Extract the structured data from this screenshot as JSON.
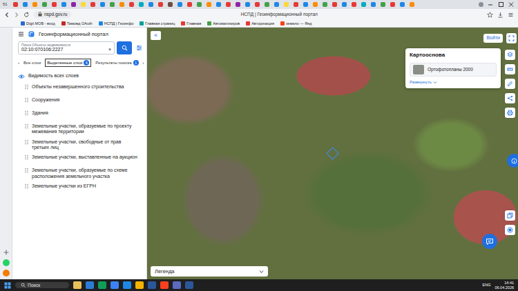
{
  "browser": {
    "tab_count": "51",
    "tabs": [
      {
        "color": "#e53935"
      },
      {
        "color": "#1e88e5"
      },
      {
        "color": "#fb8c00"
      },
      {
        "color": "#43a047"
      },
      {
        "color": "#e53935"
      },
      {
        "color": "#1e88e5"
      },
      {
        "color": "#8e24aa"
      },
      {
        "color": "#fdd835"
      },
      {
        "color": "#e53935"
      },
      {
        "color": "#1e88e5"
      },
      {
        "color": "#43a047"
      },
      {
        "color": "#fb8c00"
      },
      {
        "color": "#e53935"
      },
      {
        "color": "#00acc1"
      },
      {
        "color": "#1e88e5"
      },
      {
        "color": "#e53935"
      },
      {
        "color": "#6d4c41"
      },
      {
        "color": "#1e88e5"
      },
      {
        "color": "#e53935"
      },
      {
        "color": "#43a047"
      },
      {
        "color": "#fb8c00"
      },
      {
        "color": "#1e88e5"
      },
      {
        "color": "#e53935"
      },
      {
        "color": "#8e24aa"
      },
      {
        "color": "#1e88e5"
      },
      {
        "color": "#e53935"
      },
      {
        "color": "#43a047"
      },
      {
        "color": "#1e88e5"
      },
      {
        "color": "#fdd835"
      },
      {
        "color": "#e53935"
      },
      {
        "color": "#1e88e5"
      },
      {
        "color": "#fb8c00"
      },
      {
        "color": "#43a047"
      },
      {
        "color": "#e53935"
      },
      {
        "color": "#1e88e5"
      },
      {
        "color": "#e53935"
      },
      {
        "color": "#00acc1"
      },
      {
        "color": "#1e88e5"
      },
      {
        "color": "#43a047"
      },
      {
        "color": "#e53935"
      },
      {
        "color": "#1e88e5"
      },
      {
        "color": "#fb8c00"
      }
    ],
    "address": "nspd.gov.ru",
    "title": "НСПД | Геоинформационный портал",
    "bookmarks": [
      {
        "label": "Digit МОВ - вход",
        "color": "#2a6bd1"
      },
      {
        "label": "Таможд OAuth",
        "color": "#c62828"
      },
      {
        "label": "НСПД | Геоинфо",
        "color": "#1e88e5"
      },
      {
        "label": "Главная страниц",
        "color": "#00a0a0"
      },
      {
        "label": "Главная",
        "color": "#e53935"
      },
      {
        "label": "Автоматизиров",
        "color": "#43a047"
      },
      {
        "label": "Авторизация",
        "color": "#e53935"
      },
      {
        "label": "земело — Янд",
        "color": "#fc3f1d"
      }
    ]
  },
  "sidebar": {
    "title": "Геоинформационный портал",
    "search": {
      "label": "Поиск Объекты недвижимости",
      "value": "02:10:070106:2227",
      "clear": "×"
    },
    "tabs_prev": "‹",
    "tabs_next": "›",
    "tabs": [
      {
        "label": "Все слои",
        "badge": "",
        "selected": false
      },
      {
        "label": "Выделенные слои",
        "badge": "6",
        "selected": true
      },
      {
        "label": "Результаты поиска",
        "badge": "1",
        "selected": false
      }
    ],
    "visibility": "Видимость всех слоев",
    "layers": [
      "Объекты незавершенного строительства",
      "Сооружения",
      "Здания",
      "Земельные участки, образуемые по проекту межевания территории",
      "Земельные участки, свободные от прав третьих лиц",
      "Земельные участки, выставленные на аукцион",
      "Земельные участки, образуемые по схеме расположения земельного участка",
      "Земельные участки из ЕГРН"
    ]
  },
  "map": {
    "collapse": "«",
    "login": "Войти",
    "basemap": {
      "title": "Картооснова",
      "layer": "Ортофотопланы 2000",
      "expand": "Развернуть"
    },
    "legend": "Легенда"
  },
  "taskbar": {
    "search": "Поиск",
    "apps": [
      {
        "color": "#e8c15a"
      },
      {
        "color": "#2b7cd3"
      },
      {
        "color": "#0f9d58"
      },
      {
        "color": "#3b82f6"
      },
      {
        "color": "#1e88e5"
      },
      {
        "color": "#f4b400"
      },
      {
        "color": "#2b579a"
      },
      {
        "color": "#fc3f1d"
      },
      {
        "color": "#5c6bc0"
      },
      {
        "color": "#2b579a"
      }
    ],
    "lang": "ENG",
    "time": "14:41",
    "date": "06.04.2026"
  }
}
